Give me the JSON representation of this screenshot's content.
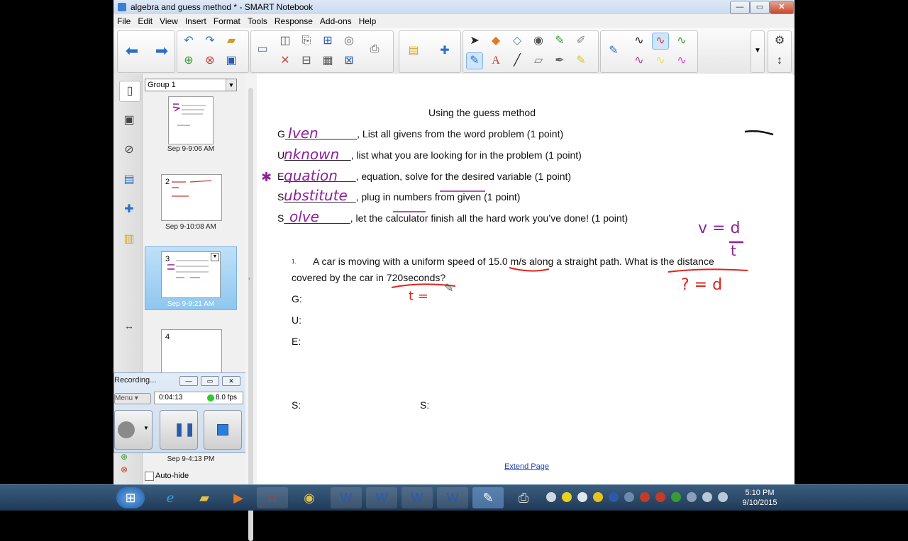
{
  "window": {
    "title": "algebra and guess method * - SMART Notebook",
    "minimize": "—",
    "maximize": "▭",
    "close": "✕"
  },
  "menu": [
    "File",
    "Edit",
    "View",
    "Insert",
    "Format",
    "Tools",
    "Response",
    "Add-ons",
    "Help"
  ],
  "sidebar": {
    "group_select": "Group 1",
    "pages": [
      {
        "caption": "Sep 9-9:06 AM"
      },
      {
        "caption": "Sep 9-10:08 AM",
        "mark": "2"
      },
      {
        "caption": "Sep 9-9:21 AM",
        "mark": "3"
      },
      {
        "caption": "4",
        "mark": "4"
      },
      {
        "caption": "Sep 9-4:13 PM"
      }
    ],
    "autohide_label": "Auto-hide"
  },
  "recorder": {
    "title": "Recording...",
    "menu_label": "Menu",
    "time": "0:04:13",
    "fps": "8.0 fps"
  },
  "page": {
    "heading": "Using the guess method",
    "steps": [
      {
        "letter": "G",
        "line": "_____________",
        "text": ", List all givens from the word problem (1 point)",
        "handwriting": "Iven"
      },
      {
        "letter": "U",
        "line": "____________",
        "text": ", list what you are looking for in the problem (1 point)",
        "handwriting": "nknown"
      },
      {
        "letter": "E",
        "line": "_____________",
        "text": ", equation, solve for the desired variable (1 point)",
        "handwriting": "quation"
      },
      {
        "letter": "S",
        "line": "_____________",
        "text": ", plug in numbers from given (1 point)",
        "handwriting": "ubstitute"
      },
      {
        "letter": "S",
        "line": "____________",
        "text": ", let the calculator finish all the hard work you’ve done! (1 point)",
        "handwriting": "olve"
      }
    ],
    "question_number": "1.",
    "question_line1": "A car is moving with a uniform speed of 15.0 m/s along a straight path. What is the distance",
    "question_line2": "covered by the car in 720seconds?",
    "labels": {
      "g": "G:",
      "u": "U:",
      "e": "E:",
      "s1": "S:",
      "s2": "S:"
    },
    "hand_notes": {
      "star": "✱",
      "formula_top": "v = d",
      "formula_bottom": "t",
      "unknown": "? = d",
      "t_eq": "t ="
    },
    "extend_page": "Extend Page"
  },
  "taskbar": {
    "clock_time": "5:10 PM",
    "clock_date": "9/10/2015"
  },
  "colors": {
    "ink_purple": "#8e1f9c",
    "ink_red": "#e0221b",
    "selection_blue": "#8fc6ef"
  }
}
